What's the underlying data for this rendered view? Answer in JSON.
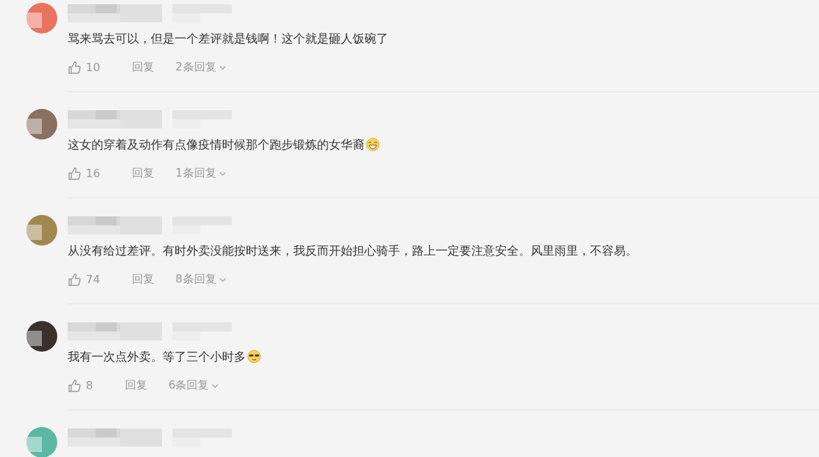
{
  "comments": [
    {
      "color": "#e8735f",
      "text": "骂来骂去可以，但是一个差评就是钱啊！这个就是砸人饭碗了",
      "likes": "10",
      "reply": "回复",
      "replies": "2条回复"
    },
    {
      "color": "#8a7060",
      "text": "这女的穿着及动作有点像疫情时候那个跑步锻炼的女华裔",
      "emoji": {
        "kind": "grin"
      },
      "likes": "16",
      "reply": "回复",
      "replies": "1条回复"
    },
    {
      "color": "#a08850",
      "text": "从没有给过差评。有时外卖没能按时送来，我反而开始担心骑手，路上一定要注意安全。风里雨里，不容易。",
      "likes": "74",
      "reply": "回复",
      "replies": "8条回复"
    },
    {
      "color": "#3a302c",
      "text": "我有一次点外卖。等了三个小时多",
      "emoji": {
        "kind": "shades"
      },
      "likes": "8",
      "reply": "回复",
      "replies": "6条回复"
    },
    {
      "color": "#5cb8a4"
    }
  ]
}
